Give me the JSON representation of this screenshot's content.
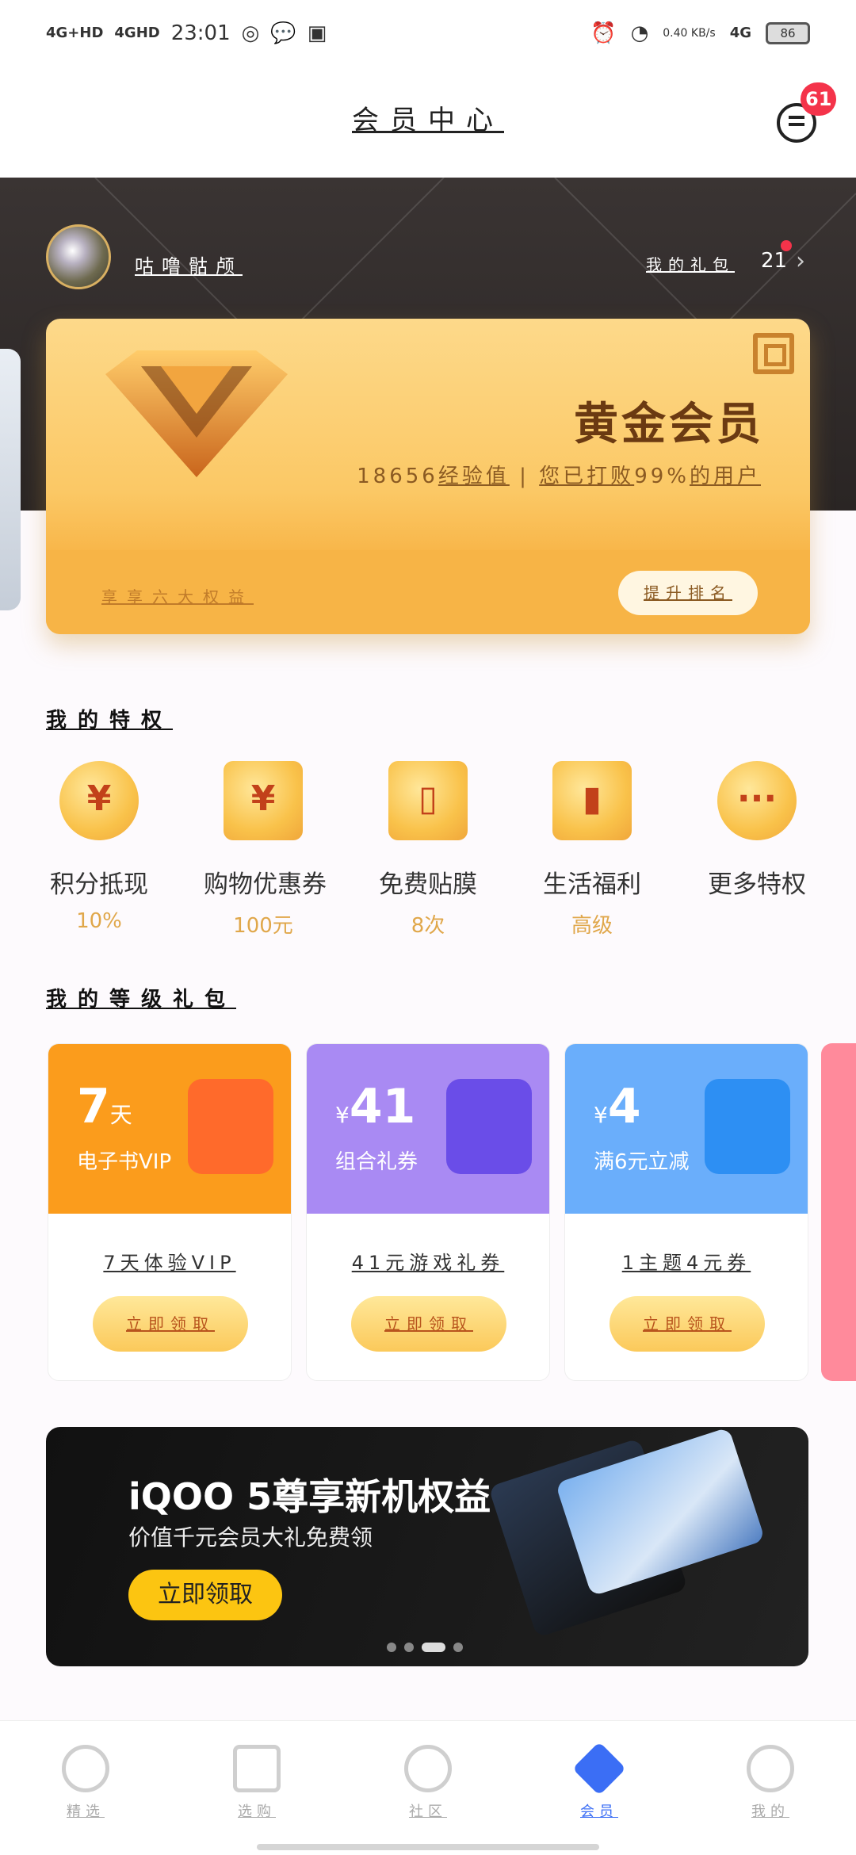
{
  "status_bar": {
    "net1": "4G+HD",
    "net2": "4GHD",
    "time": "23:01",
    "speed": "0.40 KB/s",
    "net3": "4G",
    "battery": "86"
  },
  "header": {
    "title": "会员中心",
    "message_badge": "61"
  },
  "user": {
    "name": "咕噜骷颅",
    "gift_label": "我的礼包",
    "gift_count": "21"
  },
  "member_card": {
    "tier": "黄金会员",
    "exp_value": "18656",
    "exp_label": "经验值",
    "beat_prefix": "您已打败",
    "beat_percent": "99%",
    "beat_suffix": "的用户",
    "perks_label": "享享六大权益",
    "rank_button": "提升排名"
  },
  "privileges": {
    "title": "我的特权",
    "items": [
      {
        "icon": "yen-coin-icon",
        "symbol": "¥",
        "name": "积分抵现",
        "value": "10%"
      },
      {
        "icon": "ticket-icon",
        "symbol": "¥",
        "name": "购物优惠券",
        "value": "100元"
      },
      {
        "icon": "phone-film-icon",
        "symbol": "▯",
        "name": "免费贴膜",
        "value": "8次"
      },
      {
        "icon": "gift-box-icon",
        "symbol": "▮",
        "name": "生活福利",
        "value": "高级"
      },
      {
        "icon": "more-icon",
        "symbol": "···",
        "name": "更多特权",
        "value": ""
      }
    ]
  },
  "level_gifts": {
    "title": "我的等级礼包",
    "items": [
      {
        "big": "7",
        "unit": "天",
        "sub": "电子书VIP",
        "desc": "7天体验VIP",
        "button": "立即领取",
        "color": "#fb9c1c"
      },
      {
        "big": "41",
        "unit": "¥",
        "sub": "组合礼券",
        "desc": "41元游戏礼券",
        "button": "立即领取",
        "color": "#a98af3"
      },
      {
        "big": "4",
        "unit": "¥",
        "sub": "满6元立减",
        "desc": "1主题4元券",
        "button": "立即领取",
        "color": "#6aaefb"
      }
    ]
  },
  "banner": {
    "title": "iQOO 5尊享新机权益",
    "subtitle": "价值千元会员大礼免费领",
    "button": "立即领取"
  },
  "bottom_nav": [
    {
      "label": "精选",
      "icon": "heart-icon"
    },
    {
      "label": "选购",
      "icon": "shopping-bag-icon"
    },
    {
      "label": "社区",
      "icon": "chat-bubble-icon"
    },
    {
      "label": "会员",
      "icon": "member-diamond-icon"
    },
    {
      "label": "我的",
      "icon": "smile-face-icon"
    }
  ]
}
